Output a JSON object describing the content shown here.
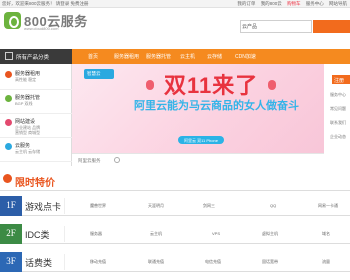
{
  "topbar": {
    "welcome": "您好，欢迎来800云服务！ 请登录  免费注册",
    "links": [
      "我的订单",
      "我的800云",
      "购物车",
      "服务中心",
      "网站导航"
    ]
  },
  "logo": {
    "name": "800云服务",
    "url": "www.cloud800.com"
  },
  "search": {
    "select": "云产品"
  },
  "nav": {
    "category": "所有产品分类",
    "items": [
      "首页",
      "服务器租用",
      "服务器托管",
      "云主机",
      "云存储",
      "CDN加速"
    ]
  },
  "sidebar": {
    "items": [
      {
        "title": "服务器租用",
        "sub1": "高性能 稳定",
        "sub2": "",
        "icon_color": "#e9551f"
      },
      {
        "title": "服务器托管",
        "sub1": "BGP 双线",
        "sub2": "",
        "icon_color": "#6cb33e"
      },
      {
        "title": "网站建设",
        "sub1": "企业建站 品牌",
        "sub2": "营销型 商城型",
        "icon_color": "#e34a6f"
      },
      {
        "title": "云服务",
        "sub1": "云主机 云存储",
        "sub2": "",
        "icon_color": "#2aa9e0"
      }
    ]
  },
  "banner": {
    "tag": "智慧云",
    "headline": "双11来了",
    "subheadline": "阿里云能为马云商品的女人做奋斗",
    "cta": "阿里云 双11 Phone",
    "colors": {
      "headline": "#e8333f",
      "sub": "#34b4e8"
    }
  },
  "right": {
    "button": "注册",
    "lines": [
      "服务中心",
      "常见问题",
      "联系我们",
      "企业动态"
    ]
  },
  "strip": {
    "label": "阿里云服务"
  },
  "section": {
    "title": "限时特价"
  },
  "floors": [
    {
      "num": "1F",
      "name": "游戏点卡",
      "cells": [
        "魔兽世界",
        "天涯明月",
        "剑网三",
        "QQ",
        "网易一卡通"
      ],
      "color": "#2c5ea8"
    },
    {
      "num": "2F",
      "name": "IDC类",
      "cells": [
        "服务器",
        "云主机",
        "VPS",
        "虚拟主机",
        "域名"
      ],
      "color": "#3c8b45"
    },
    {
      "num": "3F",
      "name": "话费类",
      "cells": [
        "移动充值",
        "联通充值",
        "电信充值",
        "固话宽带",
        "流量"
      ],
      "color": "#2c68b5"
    }
  ]
}
